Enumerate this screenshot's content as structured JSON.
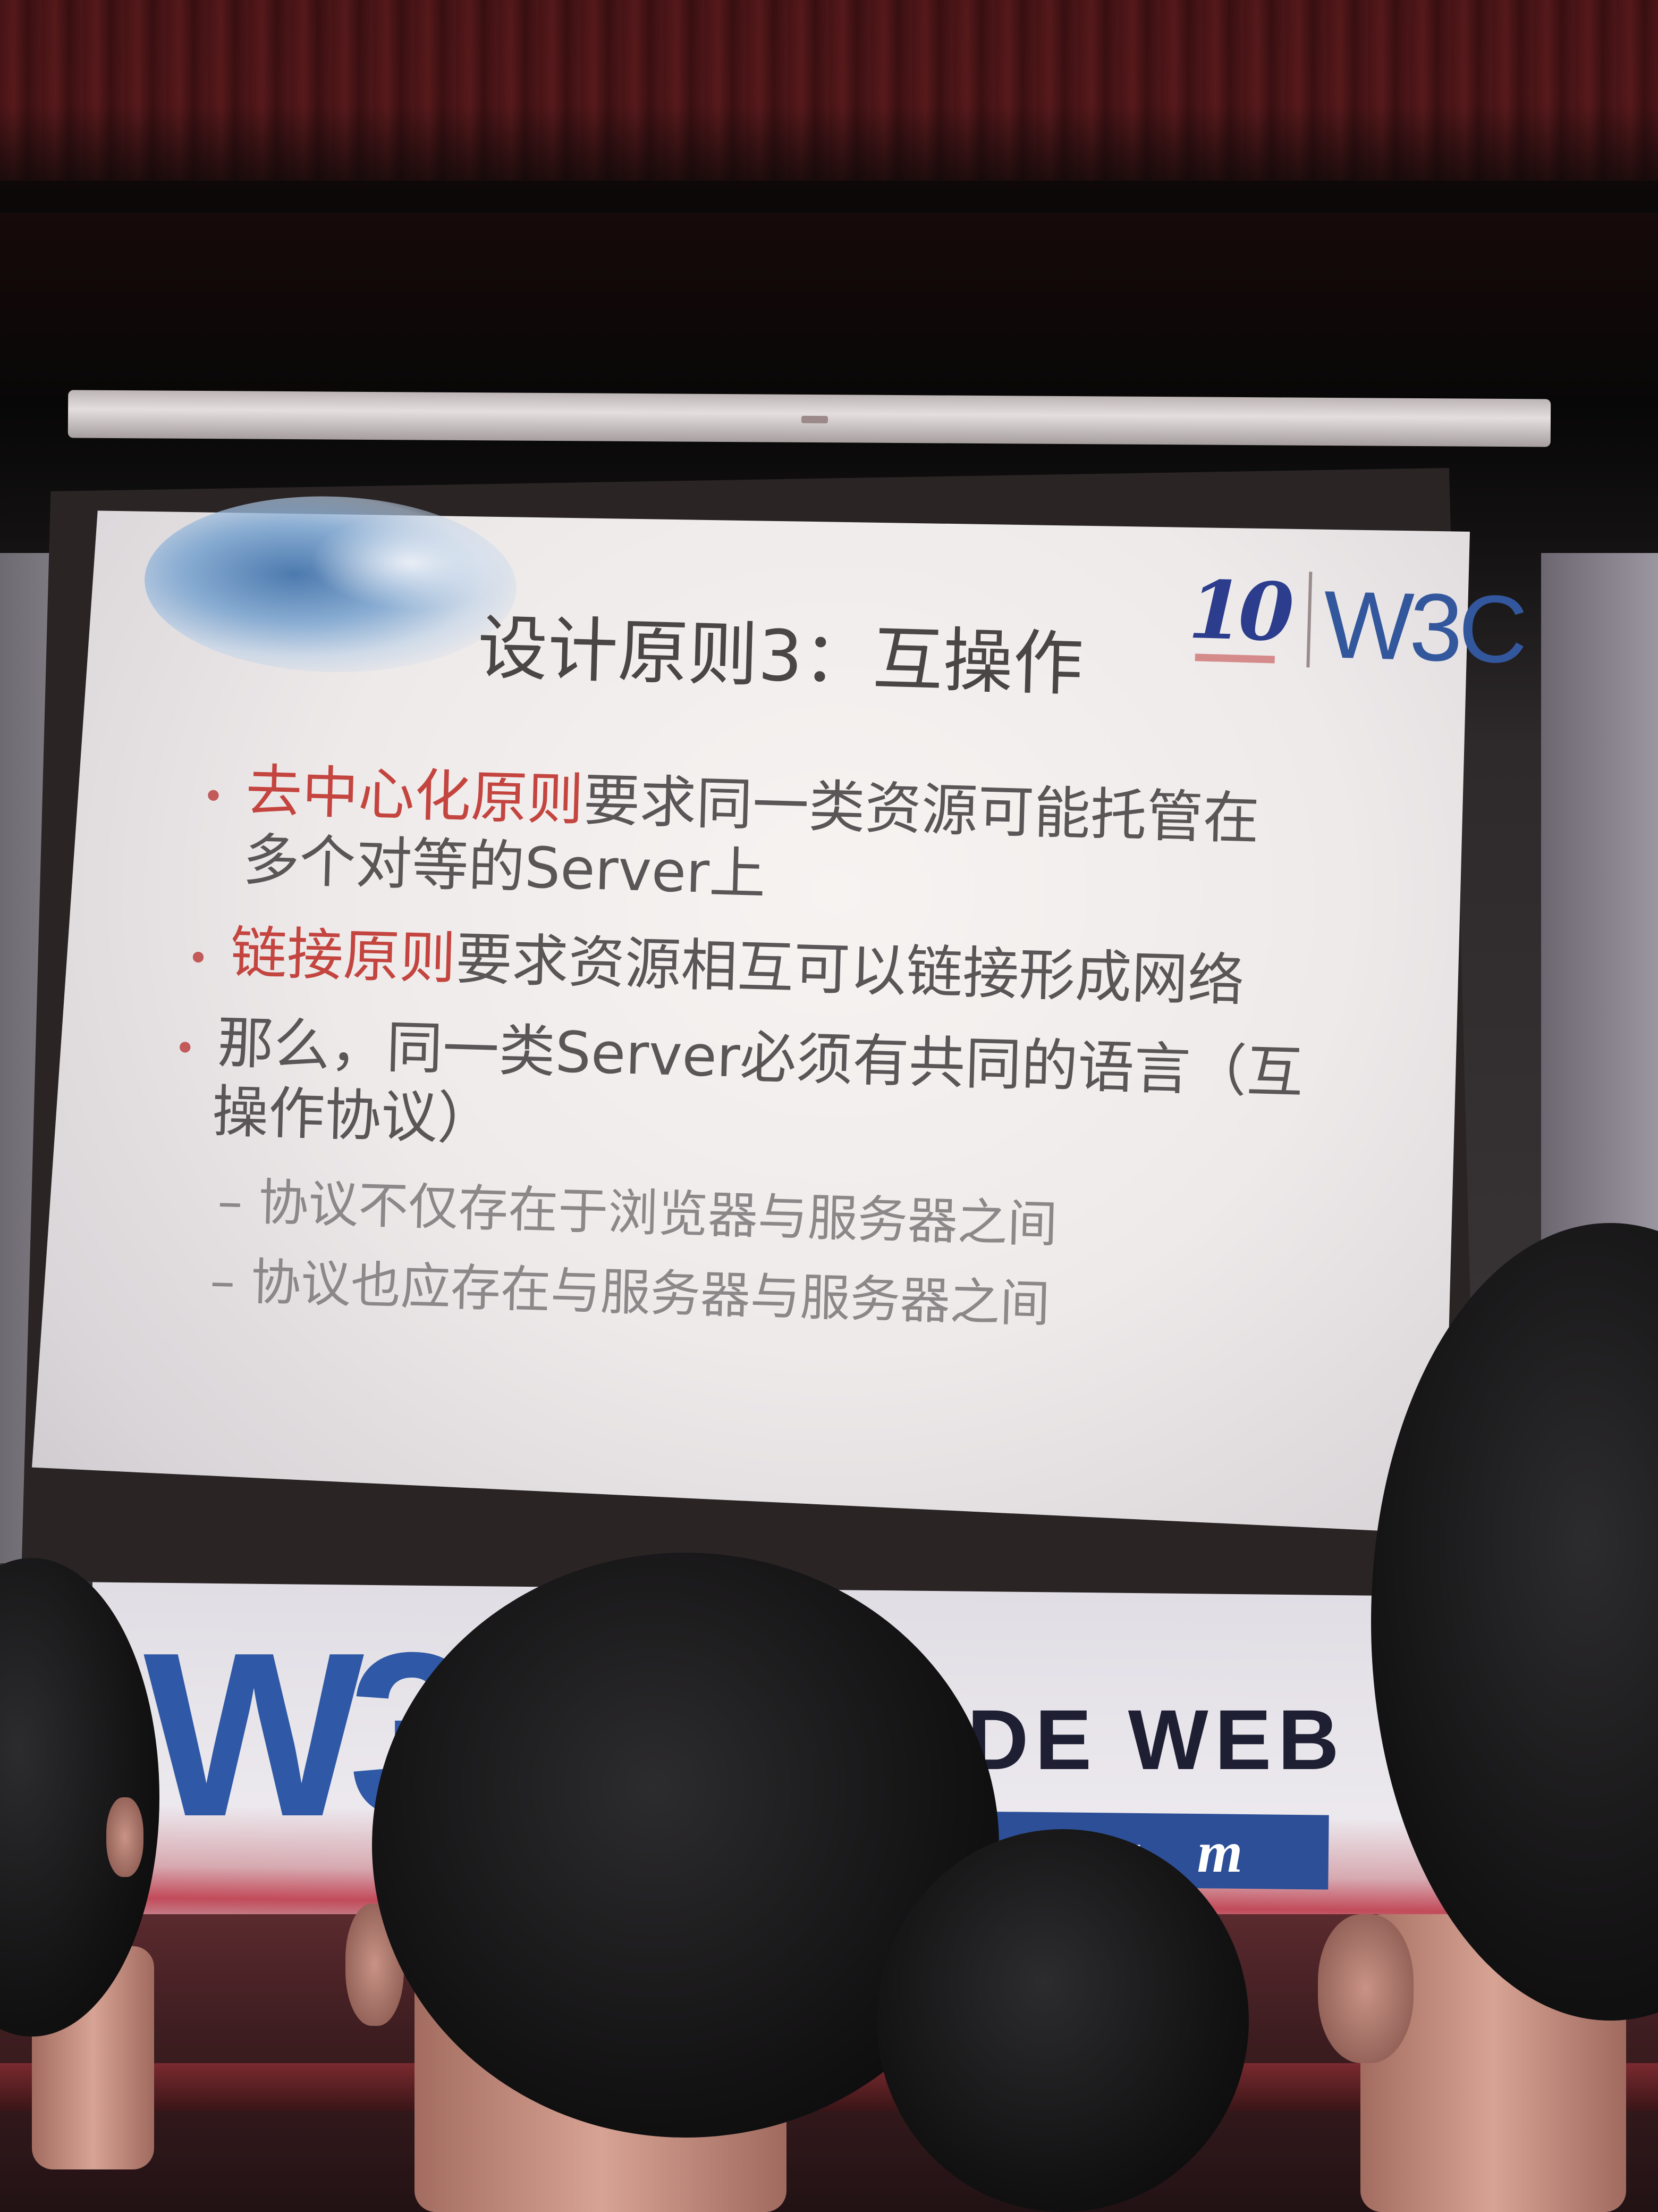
{
  "slide": {
    "title": "设计原则3：互操作",
    "logos": {
      "anniversary": "10",
      "w3c": "W3C"
    },
    "bullets": [
      {
        "highlight": "去中心化原则",
        "text": "要求同一类资源可能托管在",
        "continuation": "多个对等的Server上"
      },
      {
        "highlight": "链接原则",
        "text": "要求资源相互可以链接形成网络"
      },
      {
        "highlight": "",
        "text": "那么，同一类Server必须有共同的语言（互",
        "continuation": "操作协议）"
      }
    ],
    "sub_bullets": [
      "– 协议不仅存在于浏览器与服务器之间",
      "– 协议也应存在与服务器与服务器之间"
    ],
    "bullet_marker": "•",
    "colors": {
      "highlight": "#c4453f",
      "body_text": "#5a5557",
      "sub_text": "#8c8789"
    }
  },
  "banner": {
    "logo": "W3C",
    "partial_text_1": "DE WEB",
    "partial_text_2": "t i u m",
    "colors": {
      "logo_blue": "#2f58a6",
      "stripe_red": "#c24b5a"
    }
  }
}
